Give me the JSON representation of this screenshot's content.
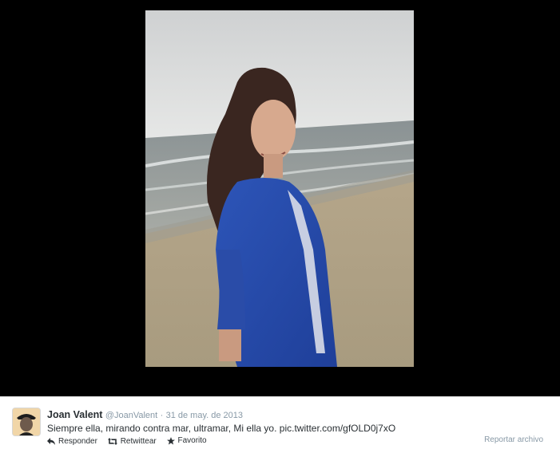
{
  "tweet": {
    "fullname": "Joan Valent",
    "username": "@JoanValent",
    "separator": "·",
    "timestamp": "31 de may. de 2013",
    "text": "Siempre ella, mirando contra mar, ultramar, Mi ella yo.",
    "pic_link": "pic.twitter.com/gfOLD0j7xO"
  },
  "actions": {
    "reply_label": "Responder",
    "retweet_label": "Retwittear",
    "favorite_label": "Favorito",
    "report_label": "Reportar archivo"
  },
  "icons": {
    "reply": "reply-icon",
    "retweet": "retweet-icon",
    "favorite": "star-icon"
  },
  "colors": {
    "stage_background": "#000000",
    "footer_background": "#ffffff",
    "name_text": "#292f33",
    "meta_text": "#8899a6"
  }
}
